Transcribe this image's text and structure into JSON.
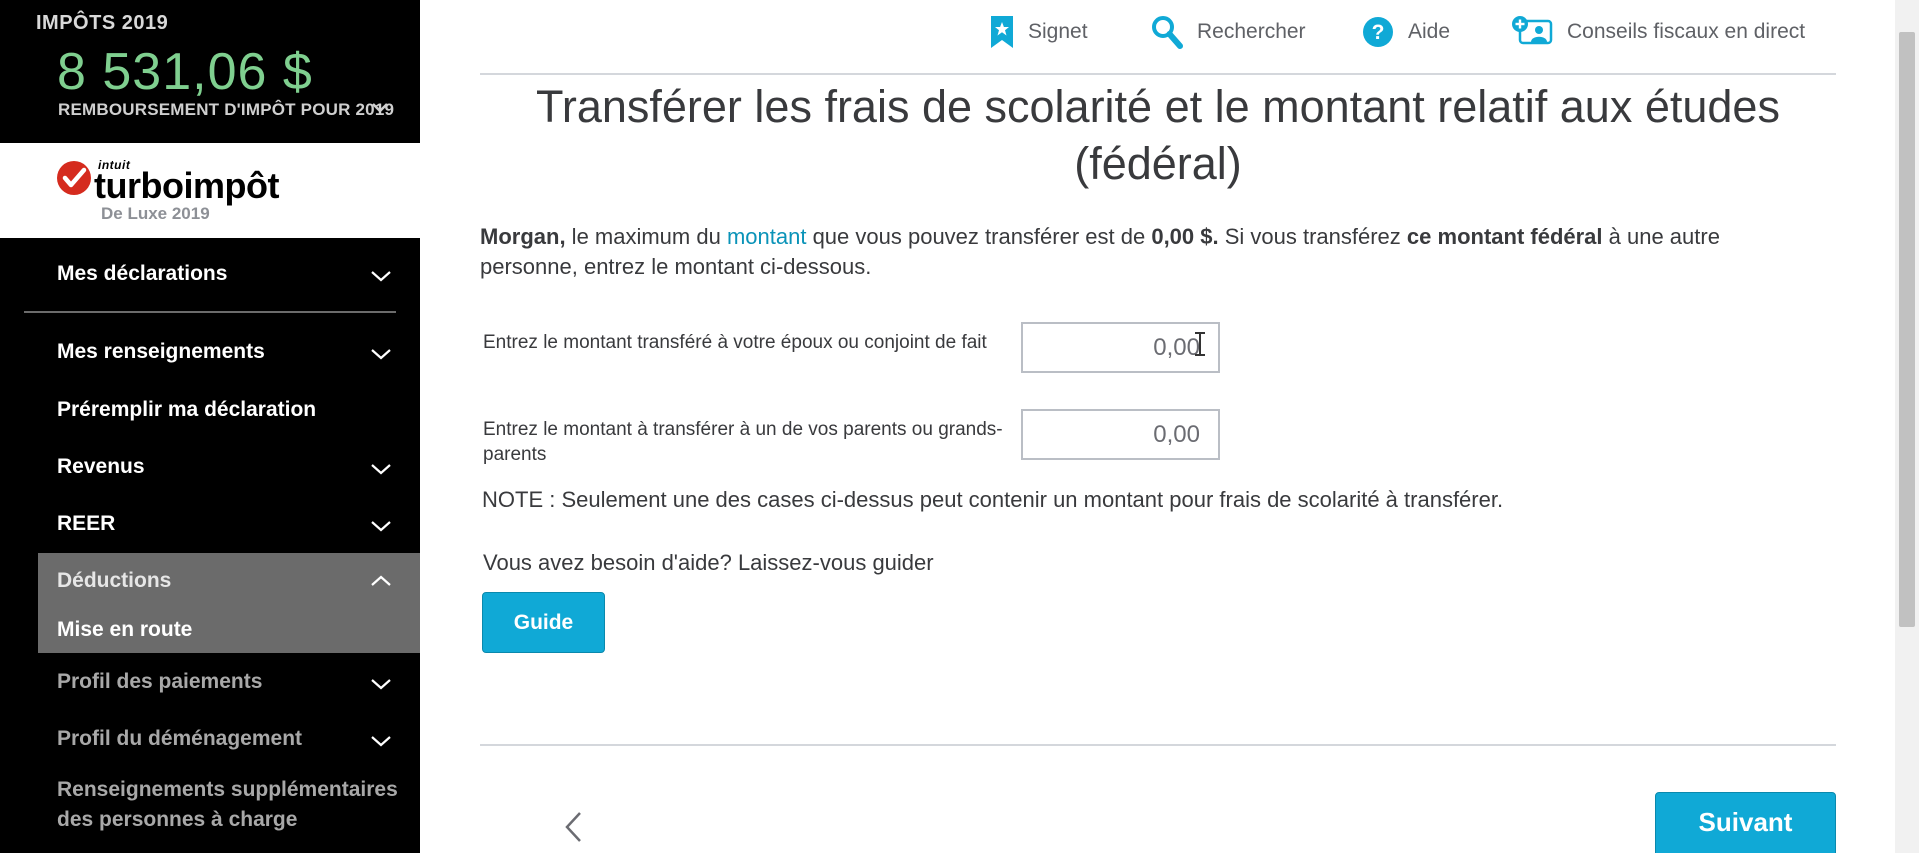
{
  "sidebar": {
    "refund": {
      "year_label": "IMPÔTS 2019",
      "amount": "8 531,06 $",
      "label": "REMBOURSEMENT D'IMPÔT POUR 2019"
    },
    "brand": {
      "company": "intuit",
      "product": "turboimpôt",
      "edition": "De Luxe 2019"
    },
    "nav": {
      "mes_declarations": "Mes déclarations",
      "mes_renseignements": "Mes renseignements",
      "preremplir": "Préremplir ma déclaration",
      "revenus": "Revenus",
      "reer": "REER",
      "deductions": "Déductions",
      "mise_en_route": "Mise en route",
      "profil_paiements": "Profil des paiements",
      "profil_demenagement": "Profil du déménagement",
      "renseignements_supp_1": "Renseignements supplémentaires",
      "renseignements_supp_2": "des personnes à charge"
    }
  },
  "toolbar": {
    "bookmark": "Signet",
    "search": "Rechercher",
    "help": "Aide",
    "live_advice": "Conseils fiscaux en direct"
  },
  "page": {
    "title_line1": "Transférer les frais de scolarité et le montant relatif aux études",
    "title_line2": "(fédéral)",
    "intro": {
      "name": "Morgan,",
      "part1": " le maximum du ",
      "link": "montant",
      "part2": " que vous pouvez transférer est de ",
      "max_amount": "0,00 $.",
      "part3": " Si vous transférez ",
      "bold2": "ce montant fédéral",
      "part4": " à une autre personne, entrez le montant ci-dessous."
    },
    "fields": {
      "spouse_label": "Entrez le montant transféré à votre époux ou conjoint de fait",
      "spouse_value": "0,00",
      "parents_label": "Entrez le montant à transférer à un de vos parents ou grands-parents",
      "parents_value": "0,00"
    },
    "note": "NOTE : Seulement une des cases ci-dessus peut contenir un montant pour frais de scolarité à transférer.",
    "help_text": "Vous avez besoin d'aide? Laissez-vous guider",
    "guide_button": "Guide",
    "next_button": "Suivant"
  },
  "colors": {
    "brand_teal": "#10a9d6",
    "refund_green": "#7fcf8f",
    "sidebar_bg": "#000000",
    "active_section_bg": "#6b6b6b",
    "brand_red": "#d52b1e"
  }
}
